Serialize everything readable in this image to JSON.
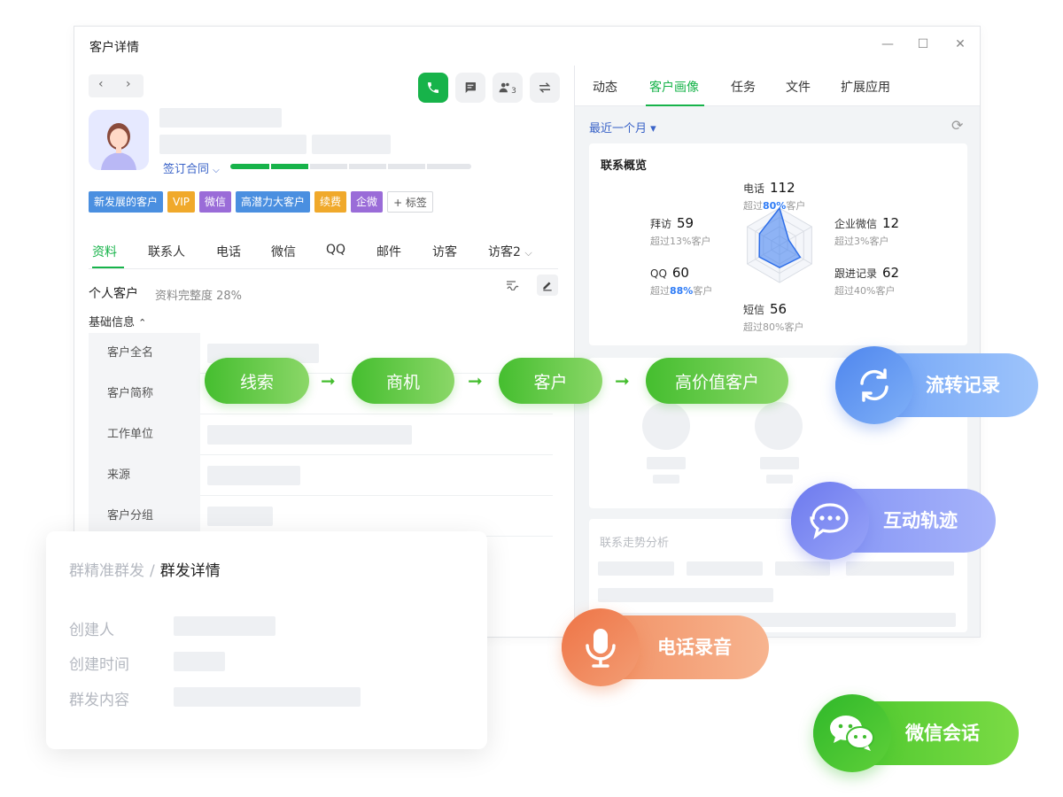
{
  "window": {
    "title": "客户详情",
    "controls": {
      "minimize": "—",
      "maximize": "☐",
      "close": "✕"
    }
  },
  "nav": {
    "prev": "‹",
    "next": "›"
  },
  "actions": {
    "phone_icon": "phone-icon",
    "message_icon": "message-icon",
    "members_count": "3",
    "transfer_icon": "transfer-icon"
  },
  "customer": {
    "contract_stage": "签订合同",
    "stage_progress": 0.32,
    "tags": [
      {
        "label": "新发展的客户",
        "color": "#4a8fe0"
      },
      {
        "label": "VIP",
        "color": "#f0a92b"
      },
      {
        "label": "微信",
        "color": "#9a6cd8"
      },
      {
        "label": "高潜力大客户",
        "color": "#4a8fe0"
      },
      {
        "label": "续费",
        "color": "#f0a92b"
      },
      {
        "label": "企微",
        "color": "#9a6cd8"
      }
    ],
    "add_tag": "+ 标签"
  },
  "tabs": [
    "资料",
    "联系人",
    "电话",
    "微信",
    "QQ",
    "邮件",
    "访客",
    "访客2"
  ],
  "profile": {
    "type": "个人客户",
    "completeness": "资料完整度 28%",
    "basic_info": "基础信息",
    "fields": [
      "客户全名",
      "客户简称",
      "工作单位",
      "来源",
      "客户分组"
    ]
  },
  "right": {
    "tabs": [
      "动态",
      "客户画像",
      "任务",
      "文件",
      "扩展应用"
    ],
    "period": "最近一个月 ▾",
    "overview": {
      "title": "联系概览",
      "radar_values": [
        112,
        12,
        62,
        56,
        60,
        59
      ],
      "metrics": [
        {
          "name": "电话",
          "value": "112",
          "sub_prefix": "超过",
          "sub_highlight": "80%",
          "sub_suffix": "客户"
        },
        {
          "name": "拜访",
          "value": "59",
          "sub_prefix": "超过13%客户",
          "sub_highlight": "",
          "sub_suffix": ""
        },
        {
          "name": "企业微信",
          "value": "12",
          "sub_prefix": "超过3%客户",
          "sub_highlight": "",
          "sub_suffix": ""
        },
        {
          "name": "QQ",
          "value": "60",
          "sub_prefix": "超过",
          "sub_highlight": "88%",
          "sub_suffix": "客户"
        },
        {
          "name": "跟进记录",
          "value": "62",
          "sub_prefix": "超过40%客户",
          "sub_highlight": "",
          "sub_suffix": ""
        },
        {
          "name": "短信",
          "value": "56",
          "sub_prefix": "超过80%客户",
          "sub_highlight": "",
          "sub_suffix": ""
        }
      ]
    },
    "trend_title": "联系走势分析"
  },
  "group_send": {
    "crumb_parent": "群精准群发",
    "crumb_sep": "/",
    "crumb_current": "群发详情",
    "labels": [
      "创建人",
      "创建时间",
      "群发内容"
    ]
  },
  "flow": [
    "线索",
    "商机",
    "客户",
    "高价值客户"
  ],
  "features": [
    {
      "label": "流转记录",
      "icon": "cycle-icon"
    },
    {
      "label": "互动轨迹",
      "icon": "chat-bubble-icon"
    },
    {
      "label": "电话录音",
      "icon": "microphone-icon"
    },
    {
      "label": "微信会话",
      "icon": "wechat-icon"
    }
  ]
}
